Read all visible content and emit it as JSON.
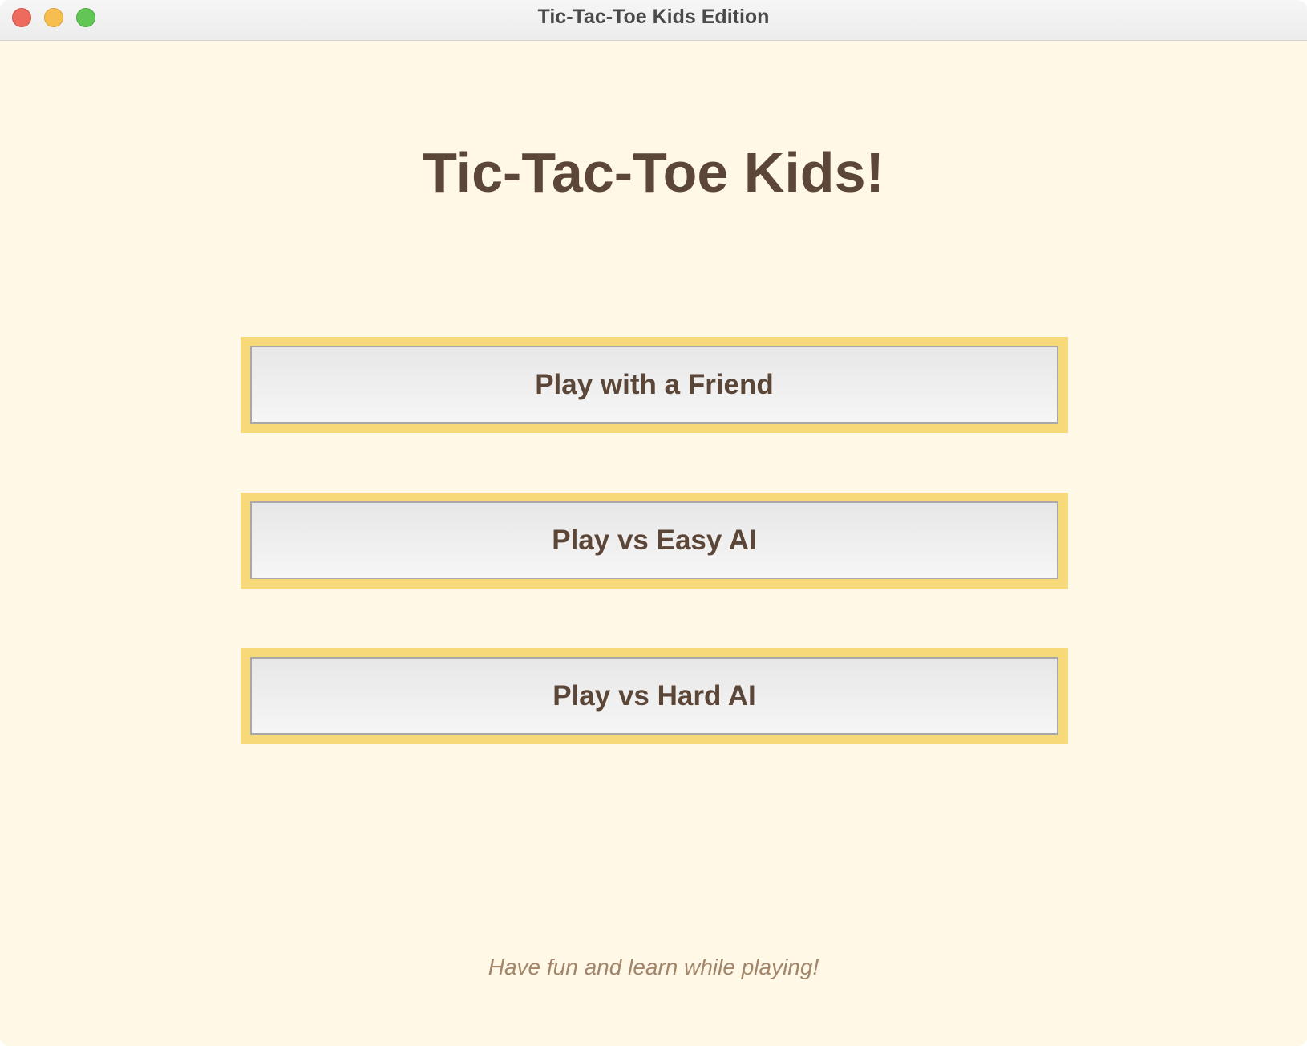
{
  "window": {
    "title": "Tic-Tac-Toe Kids Edition"
  },
  "main": {
    "heading": "Tic-Tac-Toe Kids!",
    "buttons": [
      {
        "label": "Play with a Friend"
      },
      {
        "label": "Play vs Easy AI"
      },
      {
        "label": "Play vs Hard AI"
      }
    ],
    "footer": "Have fun and learn while playing!"
  },
  "colors": {
    "background": "#fff8e7",
    "button_border": "#f8d97a",
    "text_brown": "#5b4637",
    "footer_text": "#a3856a"
  }
}
